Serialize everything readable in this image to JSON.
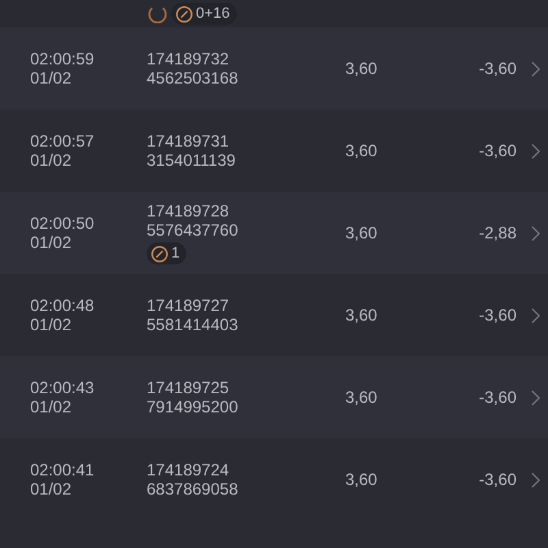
{
  "partial_row": {
    "pending": true,
    "badge": "0+16"
  },
  "rows": [
    {
      "time": "02:00:59",
      "date": "01/02",
      "id": "174189732",
      "ref": "4562503168",
      "stake": "3,60",
      "result": "-3,60"
    },
    {
      "time": "02:00:57",
      "date": "01/02",
      "id": "174189731",
      "ref": "3154011139",
      "stake": "3,60",
      "result": "-3,60"
    },
    {
      "time": "02:00:50",
      "date": "01/02",
      "id": "174189728",
      "ref": "5576437760",
      "badge": "1",
      "stake": "3,60",
      "result": "-2,88"
    },
    {
      "time": "02:00:48",
      "date": "01/02",
      "id": "174189727",
      "ref": "5581414403",
      "stake": "3,60",
      "result": "-3,60"
    },
    {
      "time": "02:00:43",
      "date": "01/02",
      "id": "174189725",
      "ref": "7914995200",
      "stake": "3,60",
      "result": "-3,60"
    },
    {
      "time": "02:00:41",
      "date": "01/02",
      "id": "174189724",
      "ref": "6837869058",
      "stake": "3,60",
      "result": "-3,60"
    }
  ]
}
